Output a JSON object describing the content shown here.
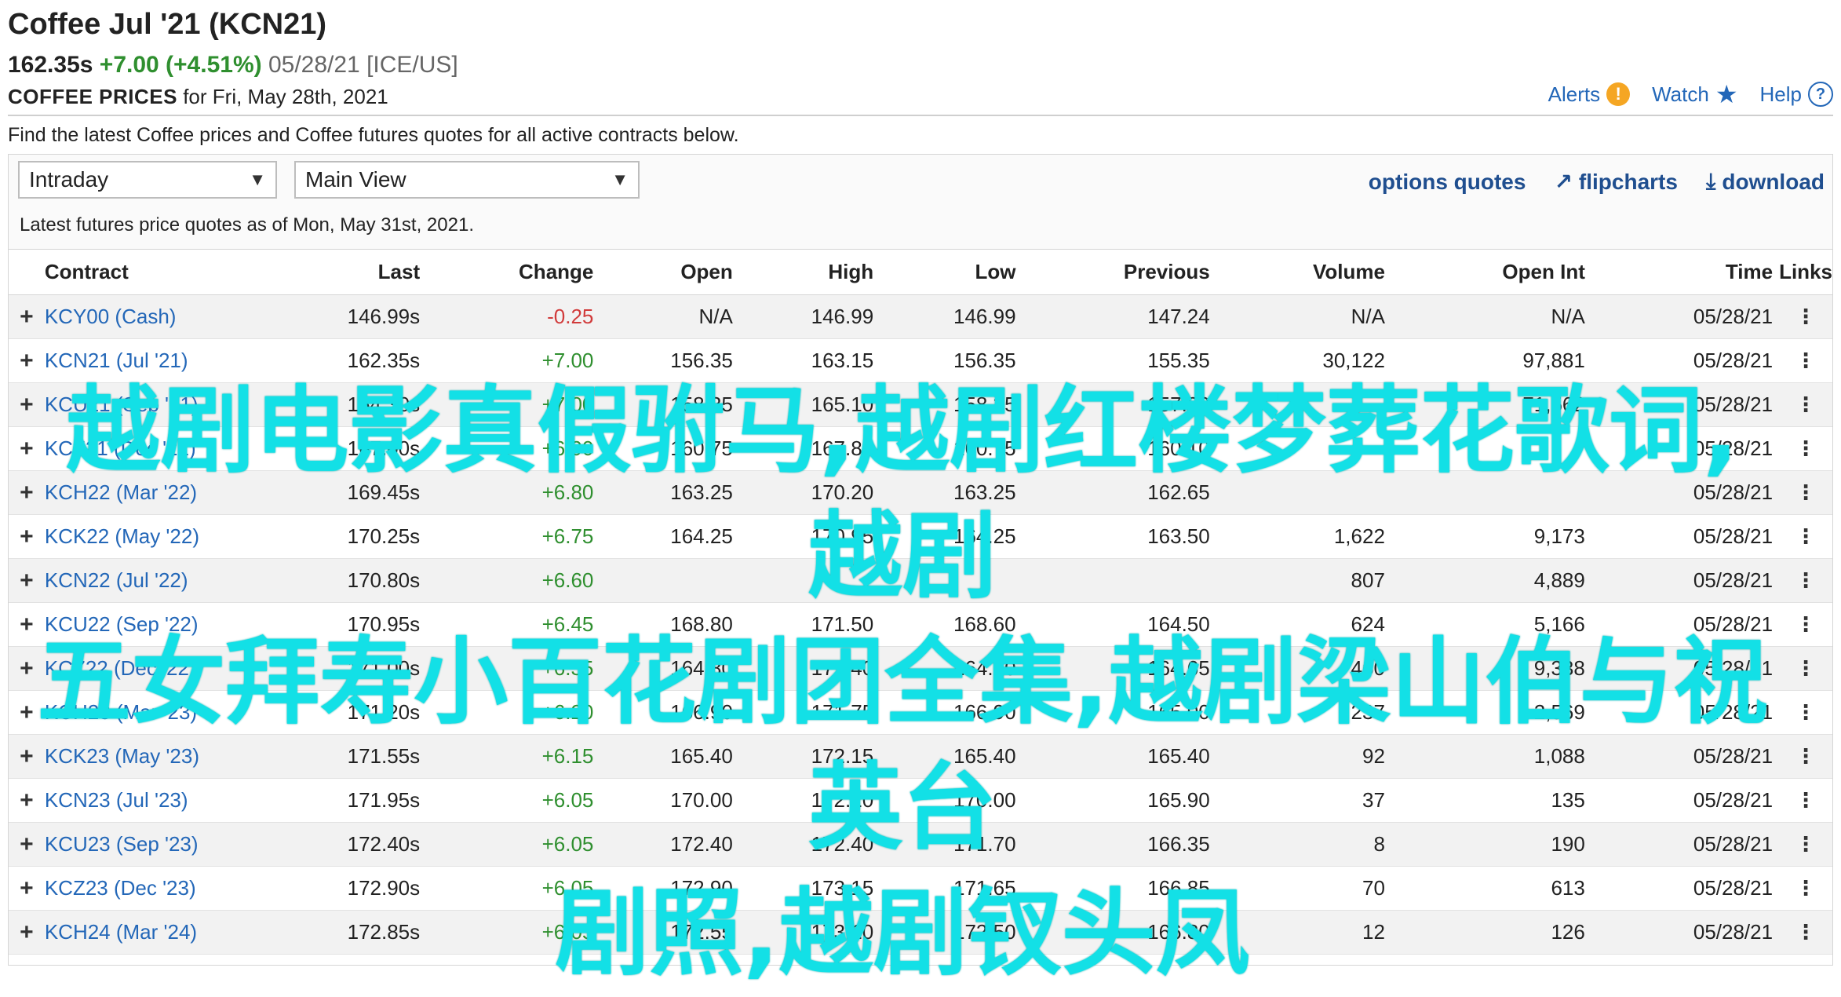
{
  "header": {
    "title": "Coffee Jul '21 (KCN21)",
    "price": "162.35s",
    "change": "+7.00 (+4.51%)",
    "date_exchange": "05/28/21 [ICE/US]",
    "subtitle_strong": "COFFEE PRICES",
    "subtitle_rest": " for Fri, May 28th, 2021",
    "links": {
      "alerts": "Alerts",
      "watch": "Watch",
      "help": "Help"
    }
  },
  "intro": "Find the latest Coffee prices and Coffee futures quotes for all active contracts below.",
  "controls": {
    "period": "Intraday",
    "view": "Main View",
    "actions": {
      "options": "options quotes",
      "flipcharts": "flipcharts",
      "download": "download"
    },
    "as_of": "Latest futures price quotes as of Mon, May 31st, 2021."
  },
  "table": {
    "columns": [
      "Contract",
      "Last",
      "Change",
      "Open",
      "High",
      "Low",
      "Previous",
      "Volume",
      "Open Int",
      "Time",
      "Links"
    ],
    "rows": [
      {
        "contract": "KCY00 (Cash)",
        "last": "146.99s",
        "change": "-0.25",
        "open": "N/A",
        "high": "146.99",
        "low": "146.99",
        "previous": "147.24",
        "volume": "N/A",
        "oi": "N/A",
        "time": "05/28/21"
      },
      {
        "contract": "KCN21 (Jul '21)",
        "last": "162.35s",
        "change": "+7.00",
        "open": "156.35",
        "high": "163.15",
        "low": "156.35",
        "previous": "155.35",
        "volume": "30,122",
        "oi": "97,881",
        "time": "05/28/21"
      },
      {
        "contract": "KCU21 (Sep '21)",
        "last": "164.30s",
        "change": "+7.00",
        "open": "158.35",
        "high": "165.10",
        "low": "158.35",
        "previous": "157.30",
        "volume": "",
        "oi": "71,562",
        "time": "05/28/21"
      },
      {
        "contract": "KCZ21 (Dec '21)",
        "last": "167.00s",
        "change": "+6.90",
        "open": "160.75",
        "high": "167.85",
        "low": "160.75",
        "previous": "160.10",
        "volume": "",
        "oi": "",
        "time": "05/28/21"
      },
      {
        "contract": "KCH22 (Mar '22)",
        "last": "169.45s",
        "change": "+6.80",
        "open": "163.25",
        "high": "170.20",
        "low": "163.25",
        "previous": "162.65",
        "volume": "",
        "oi": "",
        "time": "05/28/21"
      },
      {
        "contract": "KCK22 (May '22)",
        "last": "170.25s",
        "change": "+6.75",
        "open": "164.25",
        "high": "170.95",
        "low": "164.25",
        "previous": "163.50",
        "volume": "1,622",
        "oi": "9,173",
        "time": "05/28/21"
      },
      {
        "contract": "KCN22 (Jul '22)",
        "last": "170.80s",
        "change": "+6.60",
        "open": "",
        "high": "",
        "low": "",
        "previous": "",
        "volume": "807",
        "oi": "4,889",
        "time": "05/28/21"
      },
      {
        "contract": "KCU22 (Sep '22)",
        "last": "170.95s",
        "change": "+6.45",
        "open": "168.80",
        "high": "171.50",
        "low": "168.60",
        "previous": "164.50",
        "volume": "624",
        "oi": "5,166",
        "time": "05/28/21"
      },
      {
        "contract": "KCZ22 (Dec '22)",
        "last": "171.00s",
        "change": "+6.35",
        "open": "164.80",
        "high": "171.40",
        "low": "164.80",
        "previous": "164.65",
        "volume": "460",
        "oi": "9,338",
        "time": "05/28/21"
      },
      {
        "contract": "KCH23 (Mar '23)",
        "last": "171.20s",
        "change": "+6.20",
        "open": "166.90",
        "high": "171.75",
        "low": "166.90",
        "previous": "165.00",
        "volume": "237",
        "oi": "2,569",
        "time": "05/28/21"
      },
      {
        "contract": "KCK23 (May '23)",
        "last": "171.55s",
        "change": "+6.15",
        "open": "165.40",
        "high": "172.15",
        "low": "165.40",
        "previous": "165.40",
        "volume": "92",
        "oi": "1,088",
        "time": "05/28/21"
      },
      {
        "contract": "KCN23 (Jul '23)",
        "last": "171.95s",
        "change": "+6.05",
        "open": "170.00",
        "high": "172.10",
        "low": "170.00",
        "previous": "165.90",
        "volume": "37",
        "oi": "135",
        "time": "05/28/21"
      },
      {
        "contract": "KCU23 (Sep '23)",
        "last": "172.40s",
        "change": "+6.05",
        "open": "172.40",
        "high": "172.40",
        "low": "171.70",
        "previous": "166.35",
        "volume": "8",
        "oi": "190",
        "time": "05/28/21"
      },
      {
        "contract": "KCZ23 (Dec '23)",
        "last": "172.90s",
        "change": "+6.05",
        "open": "172.90",
        "high": "173.15",
        "low": "171.65",
        "previous": "166.85",
        "volume": "70",
        "oi": "613",
        "time": "05/28/21"
      },
      {
        "contract": "KCH24 (Mar '24)",
        "last": "172.85s",
        "change": "+6.05",
        "open": "172.55",
        "high": "173.10",
        "low": "172.50",
        "previous": "166.80",
        "volume": "12",
        "oi": "126",
        "time": "05/28/21"
      }
    ]
  },
  "overlay": {
    "line1": "越剧电影真假驸马,越剧红楼梦葬花歌词,越剧",
    "line2": "五女拜寿小百花剧团全集,越剧梁山伯与祝英台",
    "line3": "剧照,越剧钗头凤"
  },
  "colors": {
    "link": "#2367b8",
    "positive": "#2f8f2f",
    "negative": "#d13b3b",
    "overlay": "#13e0e6"
  }
}
